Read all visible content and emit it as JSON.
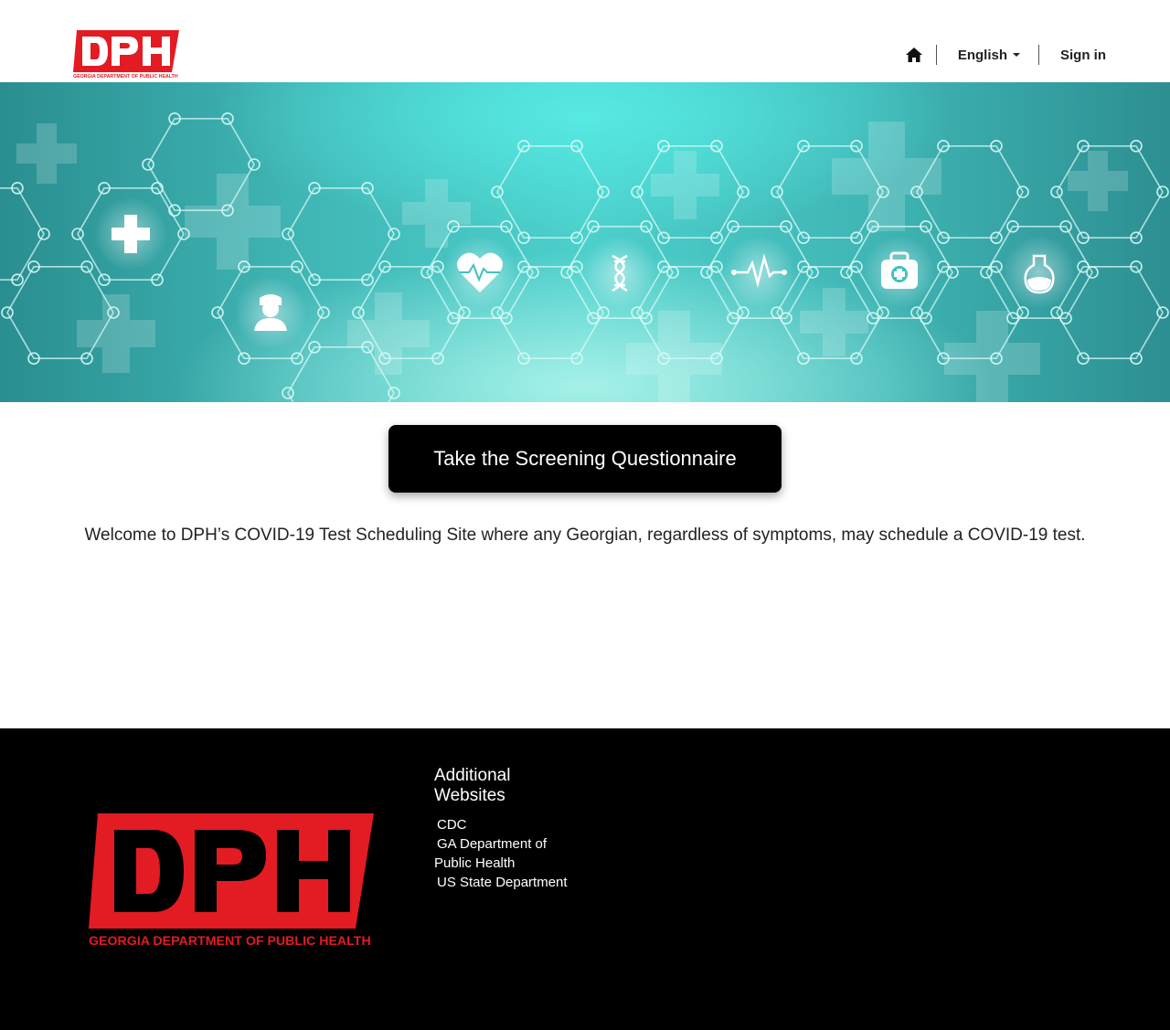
{
  "header": {
    "logo_text": "DPH",
    "logo_tagline": "GEORGIA DEPARTMENT OF PUBLIC HEALTH",
    "home_icon": "home-icon",
    "language_label": "English",
    "signin_label": "Sign in"
  },
  "hero": {
    "icons": [
      "plus-cross-icon",
      "nurse-icon",
      "heart-pulse-icon",
      "dna-icon",
      "heartbeat-line-icon",
      "medical-bag-icon",
      "flask-icon"
    ]
  },
  "cta": {
    "label": "Take the Screening Questionnaire"
  },
  "welcome_text": "Welcome to DPH’s COVID-19 Test Scheduling Site where any Georgian, regardless of symptoms, may schedule a COVID-19 test.",
  "footer": {
    "logo_text": "DPH",
    "logo_tagline": "GEORGIA DEPARTMENT OF PUBLIC HEALTH",
    "links_heading": "Additional Websites",
    "links": [
      "CDC",
      "GA Department of Public Health",
      "US State Department"
    ]
  },
  "colors": {
    "brand_red": "#e31b23",
    "cta_bg": "#000000",
    "footer_bg": "#000000",
    "hero_teal": "#4cd0cc"
  }
}
